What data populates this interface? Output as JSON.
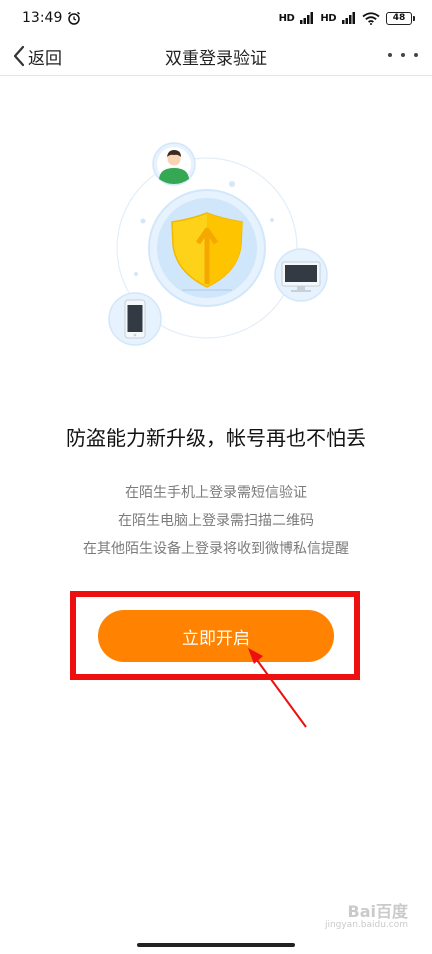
{
  "status_bar": {
    "time": "13:49",
    "signal_1": "HD",
    "signal_2": "HD",
    "battery": "48"
  },
  "nav": {
    "back_label": "返回",
    "title": "双重登录验证"
  },
  "content": {
    "headline": "防盗能力新升级，帐号再也不怕丢",
    "desc": [
      "在陌生手机上登录需短信验证",
      "在陌生电脑上登录需扫描二维码",
      "在其他陌生设备上登录将收到微博私信提醒"
    ],
    "enable_button": "立即开启"
  },
  "watermark": {
    "logo_text": "Bai百度",
    "sub_text": "jingyan.baidu.com"
  },
  "colors": {
    "accent": "#ff8200",
    "annotation": "#ee1010",
    "illustration_blue": "#cfe6fb",
    "shield_yellow": "#ffd21a"
  },
  "icons": {
    "back": "chevron-left-icon",
    "more": "more-dots-icon",
    "user": "user-avatar-icon",
    "shield": "shield-arrow-icon",
    "monitor": "monitor-icon",
    "phone": "phone-icon"
  }
}
